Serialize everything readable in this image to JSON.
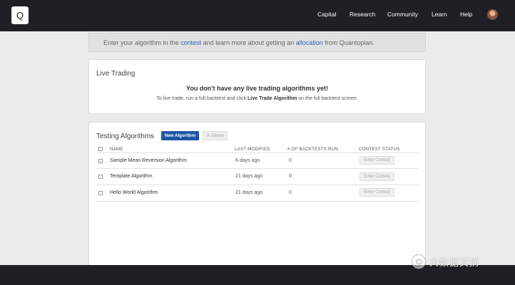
{
  "nav": {
    "logo": "Q",
    "links": [
      "Capital",
      "Research",
      "Community",
      "Learn",
      "Help"
    ]
  },
  "banner": {
    "pre": "Enter your algorithm in the ",
    "link1": "contest",
    "mid": " and learn more about getting an ",
    "link2": "allocation",
    "post": " from Quantopian."
  },
  "live": {
    "title": "Live Trading",
    "message": "You don't have any live trading algorithms yet!",
    "sub_pre": "To live trade, run a full backtest and click ",
    "sub_bold": "Live Trade Algorithm",
    "sub_post": " on the full backtest screen."
  },
  "testing": {
    "title": "Testing Algorithms",
    "new_button": "New Algorithm",
    "delete_button": "⊘ Delete",
    "columns": {
      "name": "NAME",
      "modified": "LAST MODIFIED",
      "backtests": "# OF BACKTESTS RUN",
      "status": "CONTEST STATUS"
    },
    "rows": [
      {
        "name": "Sample Mean Reversion Algorithm",
        "modified": "6 days ago",
        "backtests": "0",
        "action": "Enter Contest"
      },
      {
        "name": "Template Algorithm",
        "modified": "21 days ago",
        "backtests": "0",
        "action": "Enter Contest"
      },
      {
        "name": "Hello World Algorithm",
        "modified": "21 days ago",
        "backtests": "0",
        "action": "Enter Contest"
      }
    ]
  },
  "watermark": "大数据文摘",
  "colors": {
    "nav_bg": "#1f1f25",
    "accent": "#1d56a6",
    "link": "#2e66b8",
    "page_bg": "#ebebeb"
  }
}
